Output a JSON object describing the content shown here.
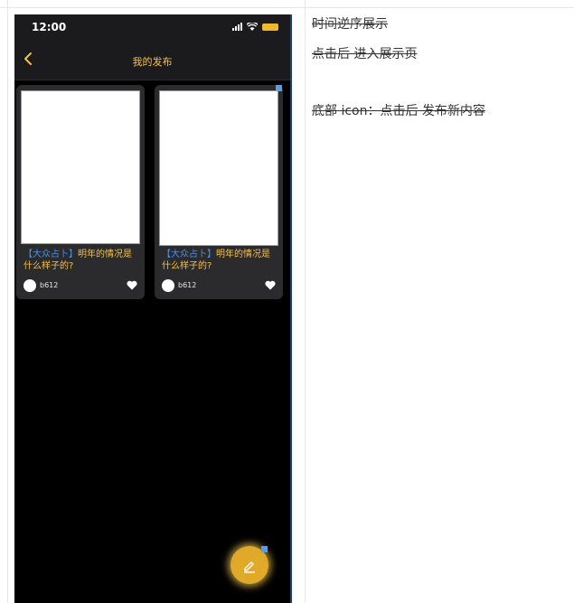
{
  "status_bar": {
    "time": "12:00"
  },
  "nav": {
    "title": "我的发布"
  },
  "cards": [
    {
      "tag": "【大众占卜】",
      "title": "明年的情况是什么样子的?",
      "username": "b612"
    },
    {
      "tag": "【大众占卜】",
      "title": "明年的情况是什么样子的?",
      "username": "b612"
    }
  ],
  "notes": [
    "时间逆序展示",
    "点击后 进入展示页",
    "底部 icon：点击后 发布新内容"
  ],
  "colors": {
    "accent": "#f5c04a",
    "tag": "#4a8fe0",
    "fab": "#e0a92a"
  }
}
